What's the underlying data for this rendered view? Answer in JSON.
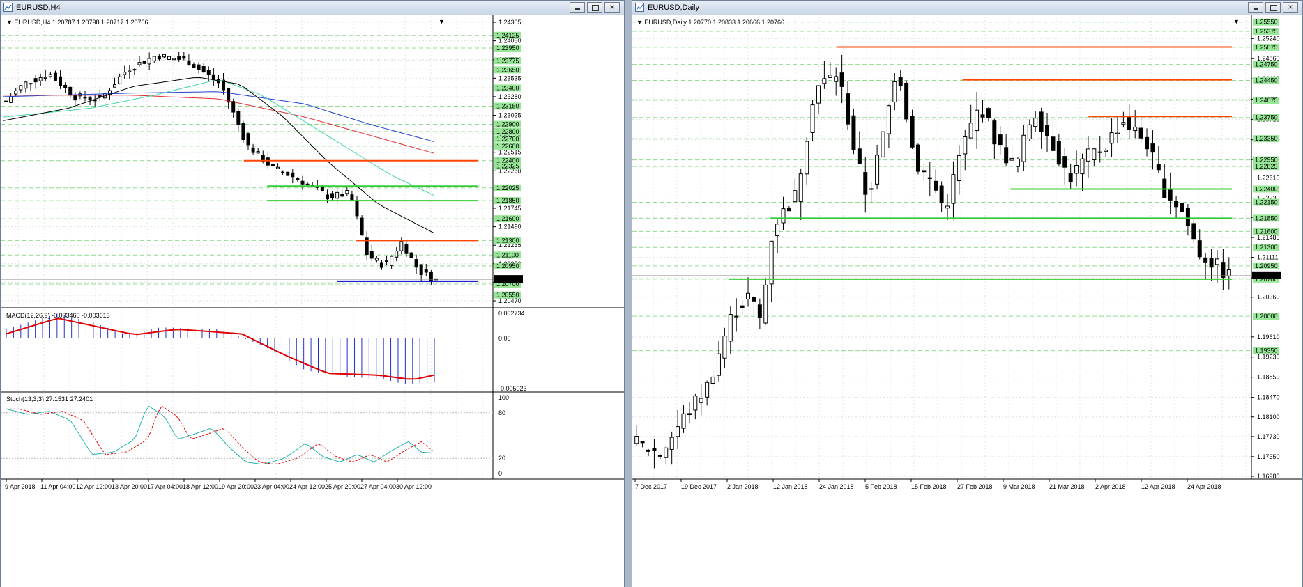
{
  "left": {
    "title": "EURUSD,H4",
    "header": "EURUSD,H4  1.20787 1.20798 1.20717 1.20766",
    "main_price_min": 1.2047,
    "main_price_max": 1.24305,
    "price_labels": [
      "1.24305",
      "1.24050",
      "1.23790",
      "1.23535",
      "1.23280",
      "1.23025",
      "1.22770",
      "1.22515",
      "1.22260",
      "1.22005",
      "1.21745",
      "1.21490",
      "1.21235",
      "1.20980",
      "1.20725",
      "1.20470"
    ],
    "green_labels": [
      "1.24125",
      "1.23950",
      "1.23775",
      "1.23650",
      "1.23400",
      "1.23150",
      "1.22900",
      "1.22800",
      "1.22700",
      "1.22600",
      "1.22400",
      "1.22325",
      "1.22025",
      "1.21850",
      "1.21600",
      "1.21300",
      "1.21100",
      "1.20950",
      "1.20700",
      "1.20550"
    ],
    "current_price": "1.20766",
    "h_lines": [
      {
        "price": 1.224,
        "color": "#ff4500",
        "from": 0.52
      },
      {
        "price": 1.2205,
        "color": "#32cd32",
        "from": 0.57
      },
      {
        "price": 1.2185,
        "color": "#32cd32",
        "from": 0.57
      },
      {
        "price": 1.213,
        "color": "#ff4500",
        "from": 0.76
      },
      {
        "price": 1.2074,
        "color": "#0000cd",
        "from": 0.72
      }
    ],
    "macd_header": "MACD(12,26,9) -0.003460 -0.003613",
    "macd_labels": [
      "0.002734",
      "0.00",
      "-0.005023"
    ],
    "stoch_header": "Stoch(13,3,3) 27.1531 27.2401",
    "stoch_labels": [
      "100",
      "80",
      "20",
      "0"
    ],
    "time_labels": [
      "9 Apr 2018",
      "11 Apr 04:00",
      "12 Apr 12:00",
      "13 Apr 20:00",
      "17 Apr 04:00",
      "18 Apr 12:00",
      "19 Apr 20:00",
      "23 Apr 04:00",
      "24 Apr 12:00",
      "25 Apr 20:00",
      "27 Apr 04:00",
      "30 Apr 12:00"
    ]
  },
  "right": {
    "title": "EURUSD,Daily",
    "header": "EURUSD,Daily  1.20770 1.20833 1.20666 1.20766",
    "price_min": 1.1698,
    "price_max": 1.2552,
    "price_labels": [
      "1.25240",
      "1.24860",
      "1.24480",
      "1.24095",
      "1.23715",
      "1.23330",
      "1.22955",
      "1.22610",
      "1.22230",
      "1.21865",
      "1.21485",
      "1.21111",
      "1.20725",
      "1.20360",
      "1.19970",
      "1.19610",
      "1.19230",
      "1.18850",
      "1.18470",
      "1.18100",
      "1.17730",
      "1.17350",
      "1.16980"
    ],
    "green_labels": [
      "1.25550",
      "1.25375",
      "1.25075",
      "1.24750",
      "1.24450",
      "1.24075",
      "1.23750",
      "1.23350",
      "1.22950",
      "1.22825",
      "1.22400",
      "1.22150",
      "1.21850",
      "1.21600",
      "1.21300",
      "1.20950",
      "1.20700",
      "1.20000",
      "1.19350"
    ],
    "current_price": "1.20766",
    "h_lines": [
      {
        "price": 1.2508,
        "color": "#ff4500",
        "from": 0.34
      },
      {
        "price": 1.2446,
        "color": "#ff4500",
        "from": 0.55
      },
      {
        "price": 1.2377,
        "color": "#ff4500",
        "from": 0.76
      },
      {
        "price": 1.224,
        "color": "#32cd32",
        "from": 0.63
      },
      {
        "price": 1.2185,
        "color": "#32cd32",
        "from": 0.23
      },
      {
        "price": 1.207,
        "color": "#32cd32",
        "from": 0.16
      }
    ],
    "time_labels": [
      "7 Dec 2017",
      "19 Dec 2017",
      "2 Jan 2018",
      "12 Jan 2018",
      "24 Jan 2018",
      "5 Feb 2018",
      "15 Feb 2018",
      "27 Feb 2018",
      "9 Mar 2018",
      "21 Mar 2018",
      "2 Apr 2018",
      "12 Apr 2018",
      "24 Apr 2018"
    ]
  }
}
